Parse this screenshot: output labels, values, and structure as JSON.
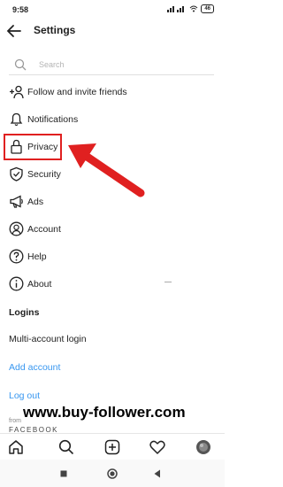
{
  "status_bar": {
    "time": "9:58",
    "battery": "46"
  },
  "header": {
    "title": "Settings"
  },
  "search": {
    "placeholder": "Search"
  },
  "menu": {
    "follow": "Follow and invite friends",
    "notifications": "Notifications",
    "privacy": "Privacy",
    "security": "Security",
    "ads": "Ads",
    "account": "Account",
    "help": "Help",
    "about": "About"
  },
  "logins": {
    "heading": "Logins",
    "multi_account": "Multi-account login",
    "add_account": "Add account",
    "log_out": "Log out"
  },
  "footer": {
    "from": "from",
    "facebook": "FACEBOOK"
  },
  "watermark": "www.buy-follower.com",
  "colors": {
    "highlight": "#e02020",
    "link": "#3897f0"
  },
  "icons": {
    "follow": "add-person-icon",
    "notifications": "bell-icon",
    "privacy": "lock-icon",
    "security": "shield-icon",
    "ads": "megaphone-icon",
    "account": "person-circle-icon",
    "help": "question-circle-icon",
    "about": "info-circle-icon"
  }
}
